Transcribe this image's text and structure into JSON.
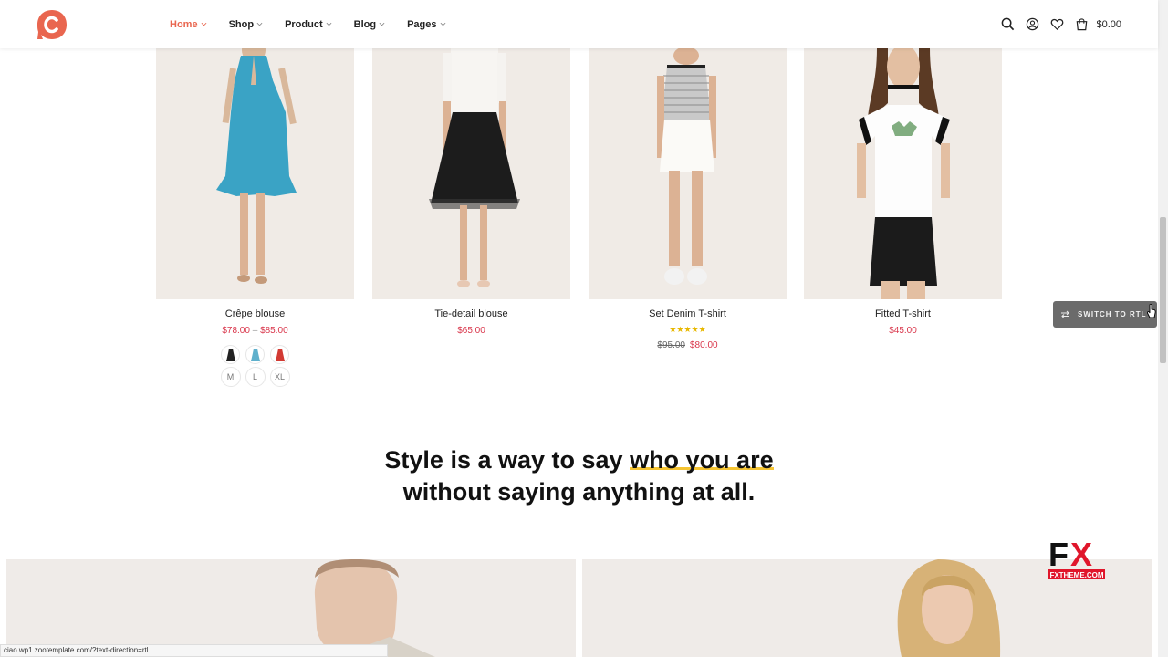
{
  "header": {
    "nav": [
      {
        "label": "Home",
        "active": true
      },
      {
        "label": "Shop",
        "active": false
      },
      {
        "label": "Product",
        "active": false
      },
      {
        "label": "Blog",
        "active": false
      },
      {
        "label": "Pages",
        "active": false
      }
    ],
    "cart_total": "$0.00",
    "icons": [
      "search-icon",
      "account-icon",
      "wishlist-icon",
      "cart-icon"
    ]
  },
  "products": [
    {
      "name": "Crêpe blouse",
      "price_low": "$78.00",
      "price_sep": "–",
      "price_high": "$85.00",
      "swatch_icons": [
        "black-dress-icon",
        "blue-dress-icon",
        "red-dress-icon"
      ],
      "sizes": [
        "M",
        "L",
        "XL"
      ]
    },
    {
      "name": "Tie-detail blouse",
      "price": "$65.00"
    },
    {
      "name": "Set Denim T-shirt",
      "rating": 5,
      "stars": "★★★★★",
      "old_price": "$95.00",
      "price": "$80.00"
    },
    {
      "name": "Fitted T-shirt",
      "price": "$45.00"
    }
  ],
  "rtl_button": {
    "label": "SWITCH TO RTL"
  },
  "headline": {
    "line1_pre": "Style is a way to say ",
    "line1_highlight": "who you are",
    "line2": "without saying anything at all."
  },
  "status_bar": {
    "url": "ciao.wp1.zootemplate.com/?text-direction=rtl"
  },
  "colors": {
    "accent": "#e9664f",
    "price": "#d9364b",
    "highlight": "#f5c432",
    "star": "#e8b800"
  }
}
